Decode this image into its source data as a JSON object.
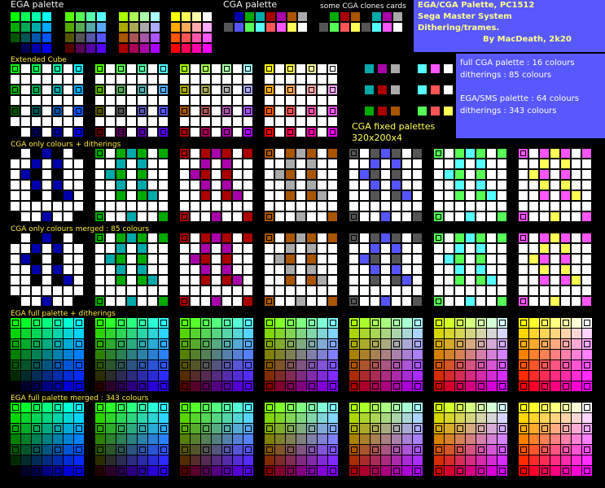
{
  "header": {
    "title": "EGA/CGA Palette, PC1512",
    "subtitle_1": "Sega Master System",
    "subtitle_2": "Dithering/trames.",
    "credit": "By MacDeath, 2k20"
  },
  "stats": {
    "line_1": "full CGA palette : 16 colours",
    "line_2": "ditherings : 85 colours",
    "line_3": "EGA/SMS palette : 64 colours",
    "line_4": "ditherings : 343 colours"
  },
  "labels": {
    "ega_palette": "EGA palette",
    "cga_palette": "CGA palette",
    "cga_clones": "some CGA clones cards",
    "extended_cube": "Extended Cube",
    "cga_fixed_1": "CGA fixed palettes",
    "cga_fixed_2": "320x200x4",
    "cga_only_dither": "CGA only colours + ditherings",
    "cga_only_merged": "CGA only colours merged : 85 colours",
    "ega_full_dither": "EGA full palette + ditherings",
    "ega_full_merged": "EGA full palette merged : 343 colours"
  },
  "colors": {
    "background": "#000000",
    "info_box": "#5858ff",
    "label_text": "#f2f2f2",
    "heading_yellow": "#ffeb3b"
  }
}
